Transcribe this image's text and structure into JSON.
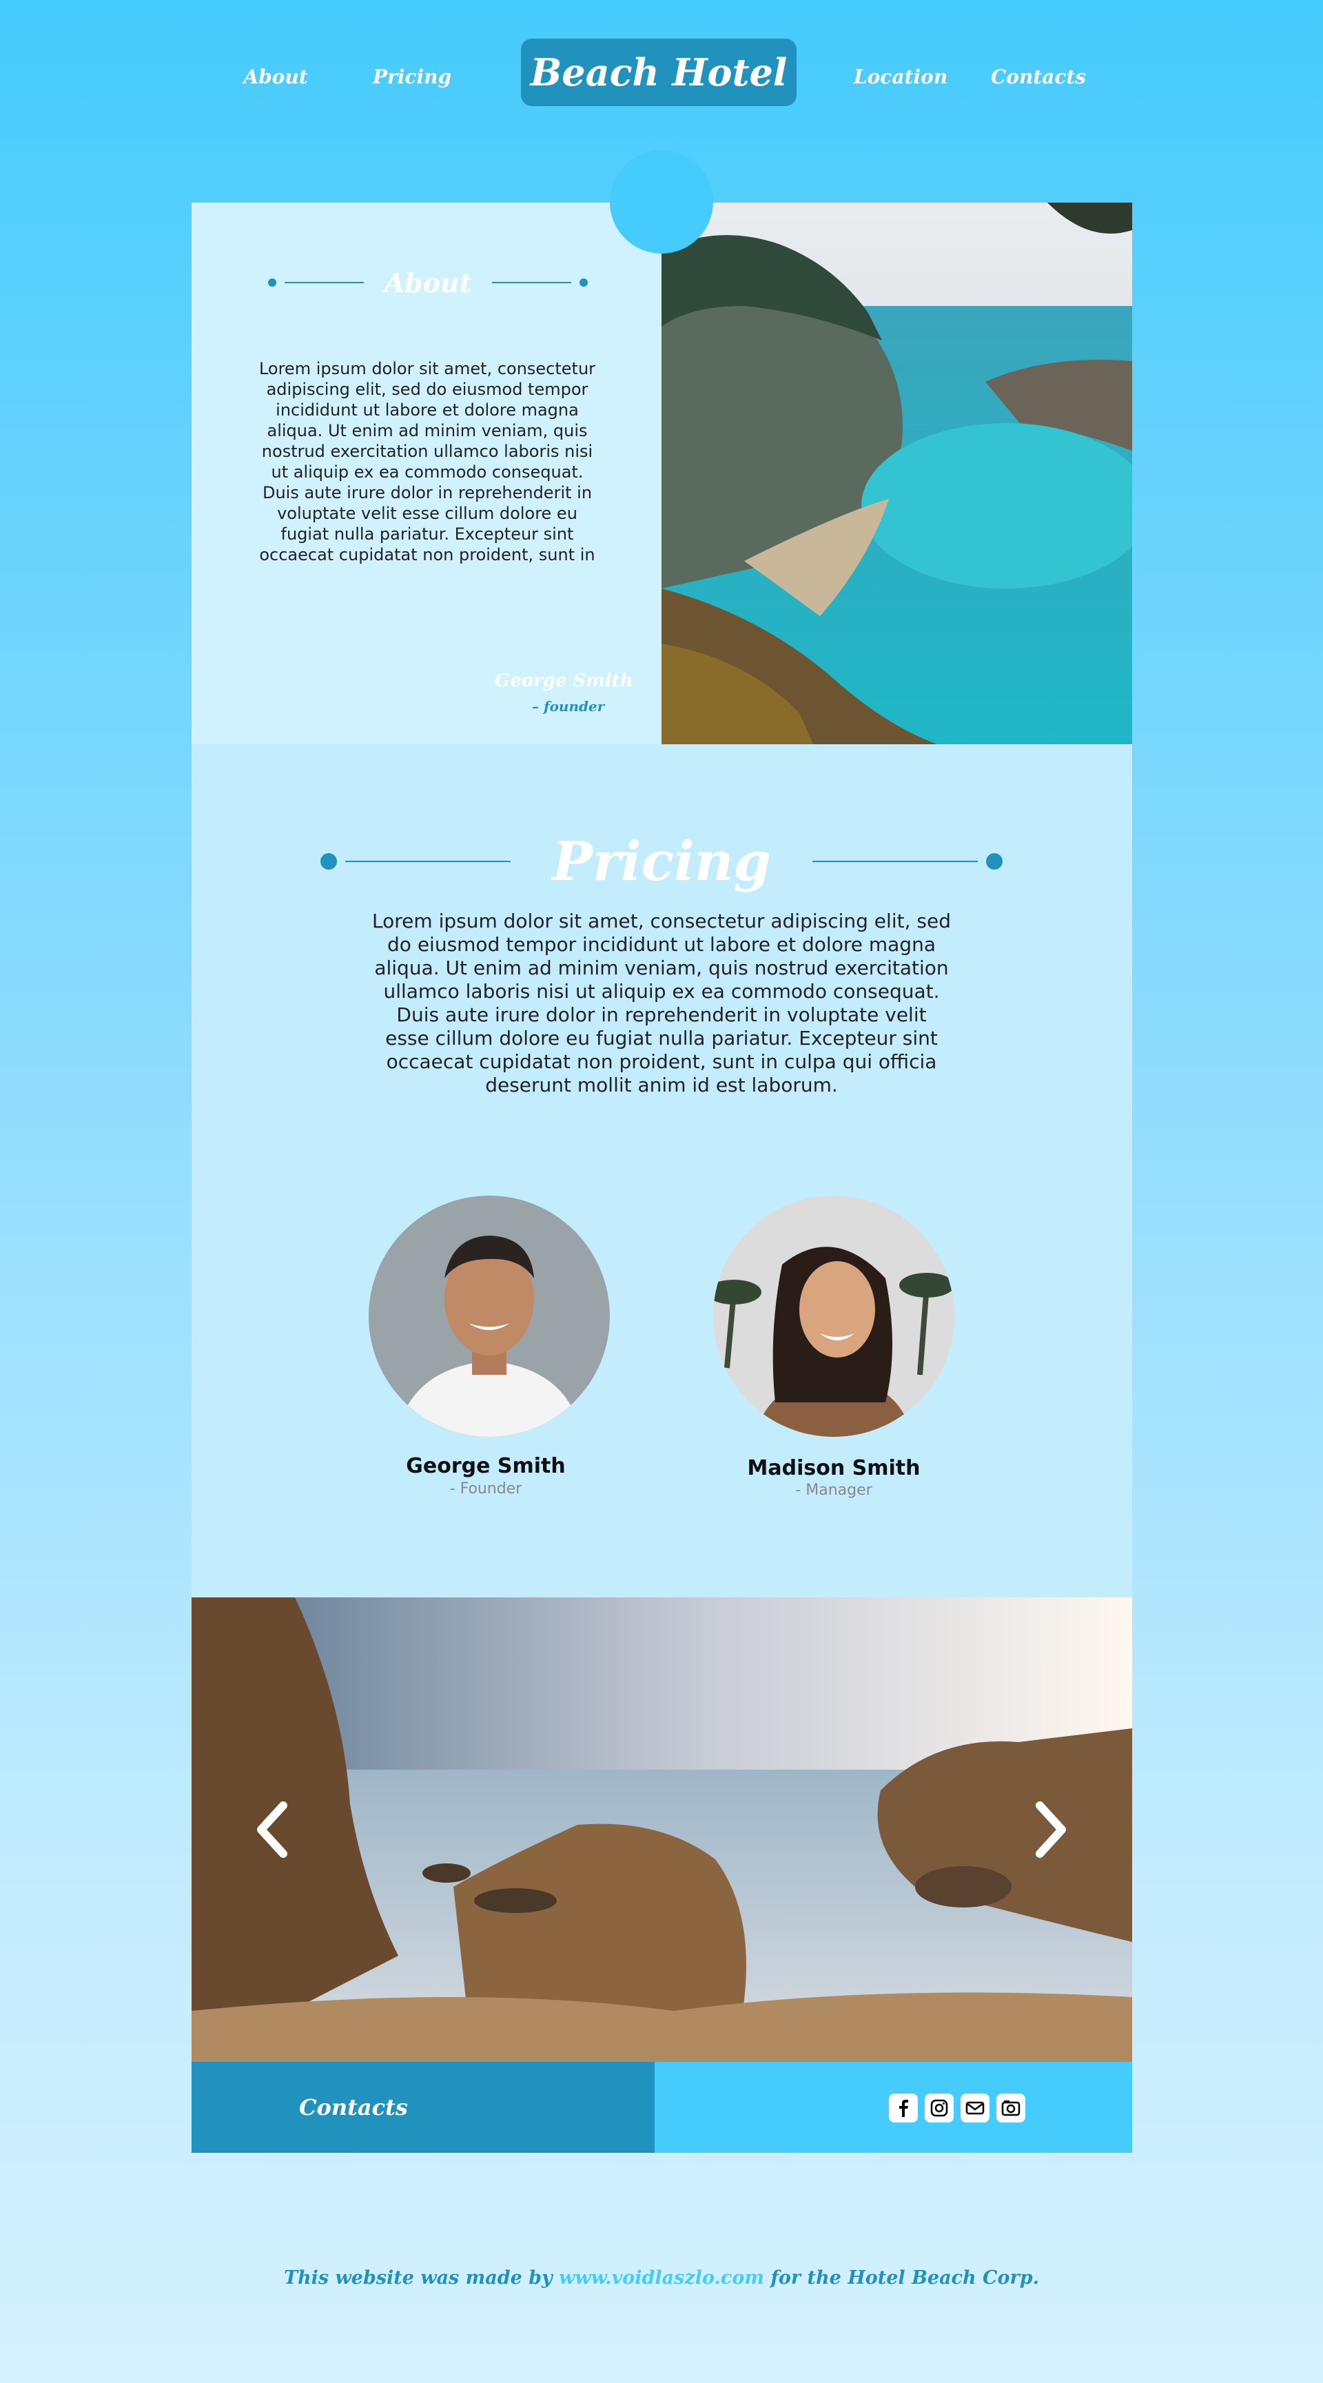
{
  "nav": {
    "links": [
      "About",
      "Pricing",
      "Location",
      "Contacts"
    ],
    "brand": "Beach Hotel"
  },
  "about": {
    "title": "About",
    "body": "Lorem ipsum dolor sit amet, consectetur adipiscing elit, sed do eiusmod tempor incididunt ut labore et dolore magna aliqua. Ut enim ad minim veniam, quis nostrud exercitation ullamco laboris nisi ut aliquip ex ea commodo consequat. Duis aute irure dolor in reprehenderit in voluptate velit esse cillum dolore eu fugiat nulla pariatur. Excepteur sint occaecat cupidatat non proident, sunt in",
    "signature_name": "George Smith",
    "signature_role": "– founder"
  },
  "pricing": {
    "title": "Pricing",
    "body": "Lorem ipsum dolor sit amet, consectetur adipiscing elit, sed do eiusmod tempor incididunt ut labore et dolore magna aliqua. Ut enim ad minim veniam, quis nostrud exercitation ullamco laboris nisi ut aliquip ex ea commodo consequat. Duis aute irure dolor in reprehenderit in voluptate velit esse cillum dolore eu fugiat nulla pariatur. Excepteur sint occaecat cupidatat non proident, sunt in culpa qui officia deserunt mollit anim id est laborum.",
    "team": [
      {
        "name": "George Smith",
        "role": "- Founder"
      },
      {
        "name": "Madison Smith",
        "role": "- Manager"
      }
    ]
  },
  "slider": {
    "prev_icon": "chevron-left-icon",
    "next_icon": "chevron-right-icon"
  },
  "contacts": {
    "title": "Contacts",
    "social_icons": [
      "facebook-icon",
      "instagram-icon",
      "mail-icon",
      "camera-icon"
    ]
  },
  "footer": {
    "prefix": "This website was made by",
    "link": "www.voidlaszlo.com",
    "suffix": "for the Hotel Beach Corp."
  },
  "colors": {
    "accent": "#2192bd",
    "sky": "#45cbfc",
    "panel_light": "#d0f2fe",
    "panel_pricing": "#c3edfd"
  }
}
